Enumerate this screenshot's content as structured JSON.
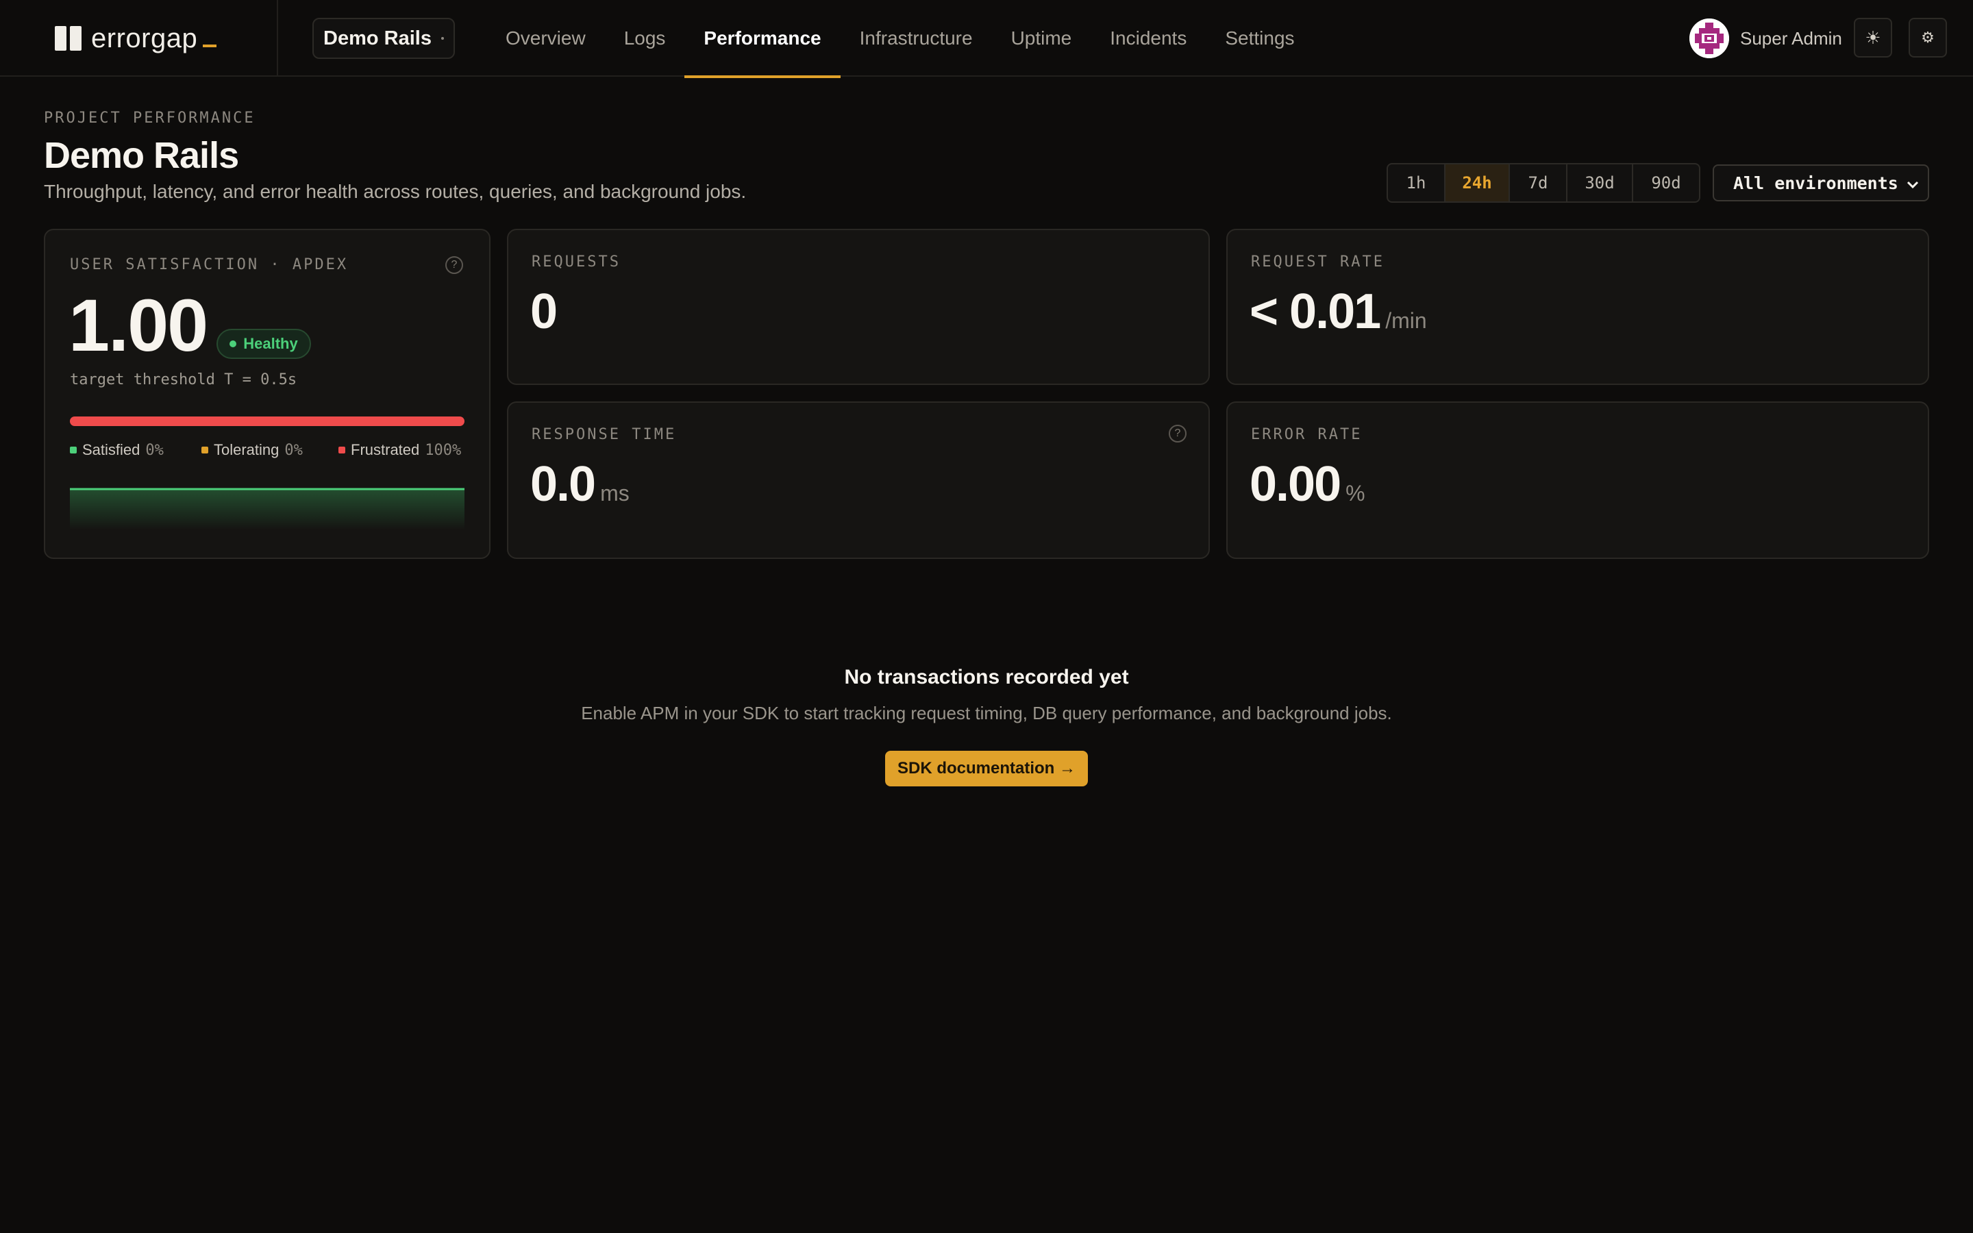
{
  "brand": {
    "name": "errorgap"
  },
  "project_switcher": {
    "label": "Demo Rails"
  },
  "nav": [
    {
      "label": "Overview",
      "active": false
    },
    {
      "label": "Logs",
      "active": false
    },
    {
      "label": "Performance",
      "active": true
    },
    {
      "label": "Infrastructure",
      "active": false
    },
    {
      "label": "Uptime",
      "active": false
    },
    {
      "label": "Incidents",
      "active": false
    },
    {
      "label": "Settings",
      "active": false
    }
  ],
  "user": {
    "name": "Super Admin"
  },
  "toolbar": {
    "theme_icon": "☀",
    "settings_icon": "⚙"
  },
  "header": {
    "eyebrow": "PROJECT PERFORMANCE",
    "title": "Demo Rails",
    "subtitle": "Throughput, latency, and error health across routes, queries, and background jobs."
  },
  "ranges": [
    {
      "label": "1h",
      "active": false
    },
    {
      "label": "24h",
      "active": true
    },
    {
      "label": "7d",
      "active": false
    },
    {
      "label": "30d",
      "active": false
    },
    {
      "label": "90d",
      "active": false
    }
  ],
  "environment": {
    "selected": "All environments"
  },
  "apdex": {
    "label": "USER SATISFACTION · APDEX",
    "help": "?",
    "value": "1.00",
    "status": "Healthy",
    "threshold": "target threshold T = 0.5s",
    "frustrated_fraction": 1.0,
    "legend": [
      {
        "label": "Satisfied",
        "pct": "0%",
        "color": "#4cd07a"
      },
      {
        "label": "Tolerating",
        "pct": "0%",
        "color": "#e0a12a"
      },
      {
        "label": "Frustrated",
        "pct": "100%",
        "color": "#ef4b4b"
      }
    ]
  },
  "requests": {
    "label": "REQUESTS",
    "value": "0"
  },
  "request_rate": {
    "label": "REQUEST RATE",
    "value": "< 0.01",
    "unit": "/min"
  },
  "response_time": {
    "label": "RESPONSE TIME",
    "help": "?",
    "value": "0.0",
    "unit": "ms"
  },
  "error_rate": {
    "label": "ERROR RATE",
    "value": "0.00",
    "unit": "%"
  },
  "empty_state": {
    "title": "No transactions recorded yet",
    "subtitle": "Enable APM in your SDK to start tracking request timing, DB query performance, and background jobs.",
    "cta": "SDK documentation →"
  },
  "colors": {
    "accent": "#e0a12a",
    "healthy": "#4cd07a",
    "danger": "#ef4b4b",
    "background": "#0d0c0b"
  }
}
